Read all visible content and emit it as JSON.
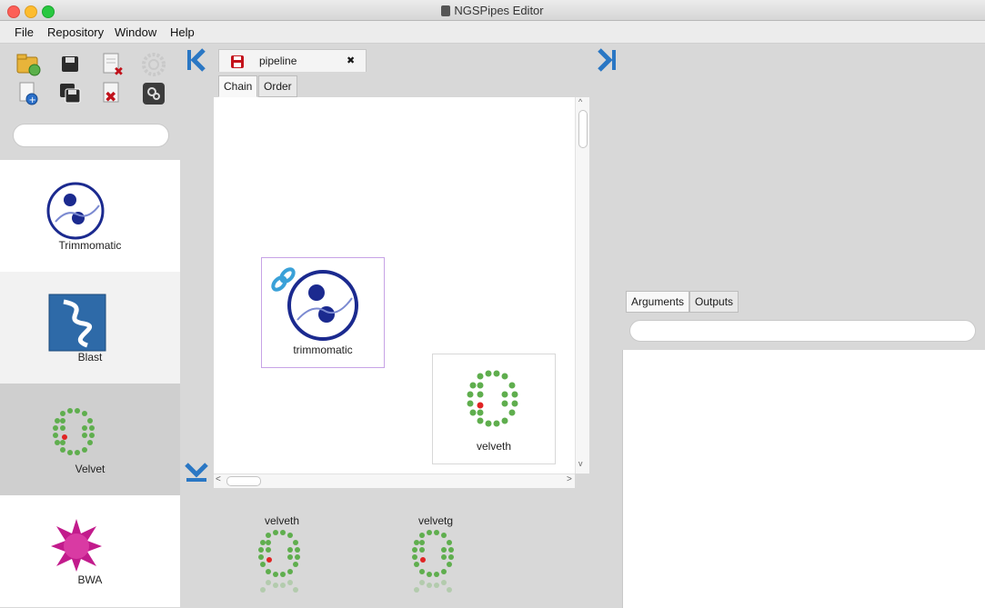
{
  "window": {
    "title": "NGSPipes Editor"
  },
  "menu": {
    "items": [
      "File",
      "Repository",
      "Window",
      "Help"
    ]
  },
  "search": {
    "left_placeholder": "",
    "right_placeholder": ""
  },
  "tools": [
    {
      "label": "Trimmomatic"
    },
    {
      "label": "Blast"
    },
    {
      "label": "Velvet"
    },
    {
      "label": "BWA"
    }
  ],
  "editor": {
    "tab_label": "pipeline",
    "tab_close": "✖",
    "subtabs": [
      "Chain",
      "Order"
    ],
    "nodes": [
      {
        "label": "trimmomatic"
      },
      {
        "label": "velveth"
      }
    ]
  },
  "palette_bottom": [
    {
      "label": "velveth"
    },
    {
      "label": "velvetg"
    }
  ],
  "properties": {
    "tabs": [
      "Arguments",
      "Outputs"
    ]
  },
  "colors": {
    "accent": "#2a77c4",
    "bg": "#d8d8d8",
    "node_border": "#c7a3e6"
  }
}
